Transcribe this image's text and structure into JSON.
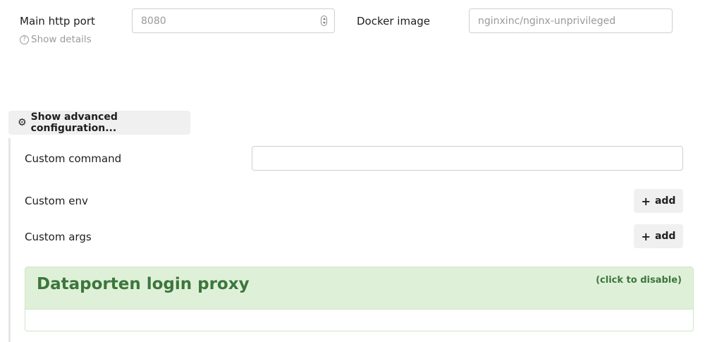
{
  "ports": {
    "main_http_port_label": "Main http port",
    "main_http_port_value": "8080",
    "show_details_label": "Show details",
    "help_icon": "question-circle-icon"
  },
  "docker": {
    "label": "Docker image",
    "placeholder": "nginxinc/nginx-unprivileged"
  },
  "advanced": {
    "toggle_label": "Show advanced configuration...",
    "toggle_icon": "gear-icon",
    "custom_command_label": "Custom command",
    "custom_command_value": "",
    "custom_env_label": "Custom env",
    "custom_env_add_label": "add",
    "custom_args_label": "Custom args",
    "custom_args_add_label": "add"
  },
  "login_proxy": {
    "title": "Dataporten login proxy",
    "toggle_label": "(click to disable)",
    "header_bg": "#dff0d8",
    "text_color": "#3c763d"
  }
}
